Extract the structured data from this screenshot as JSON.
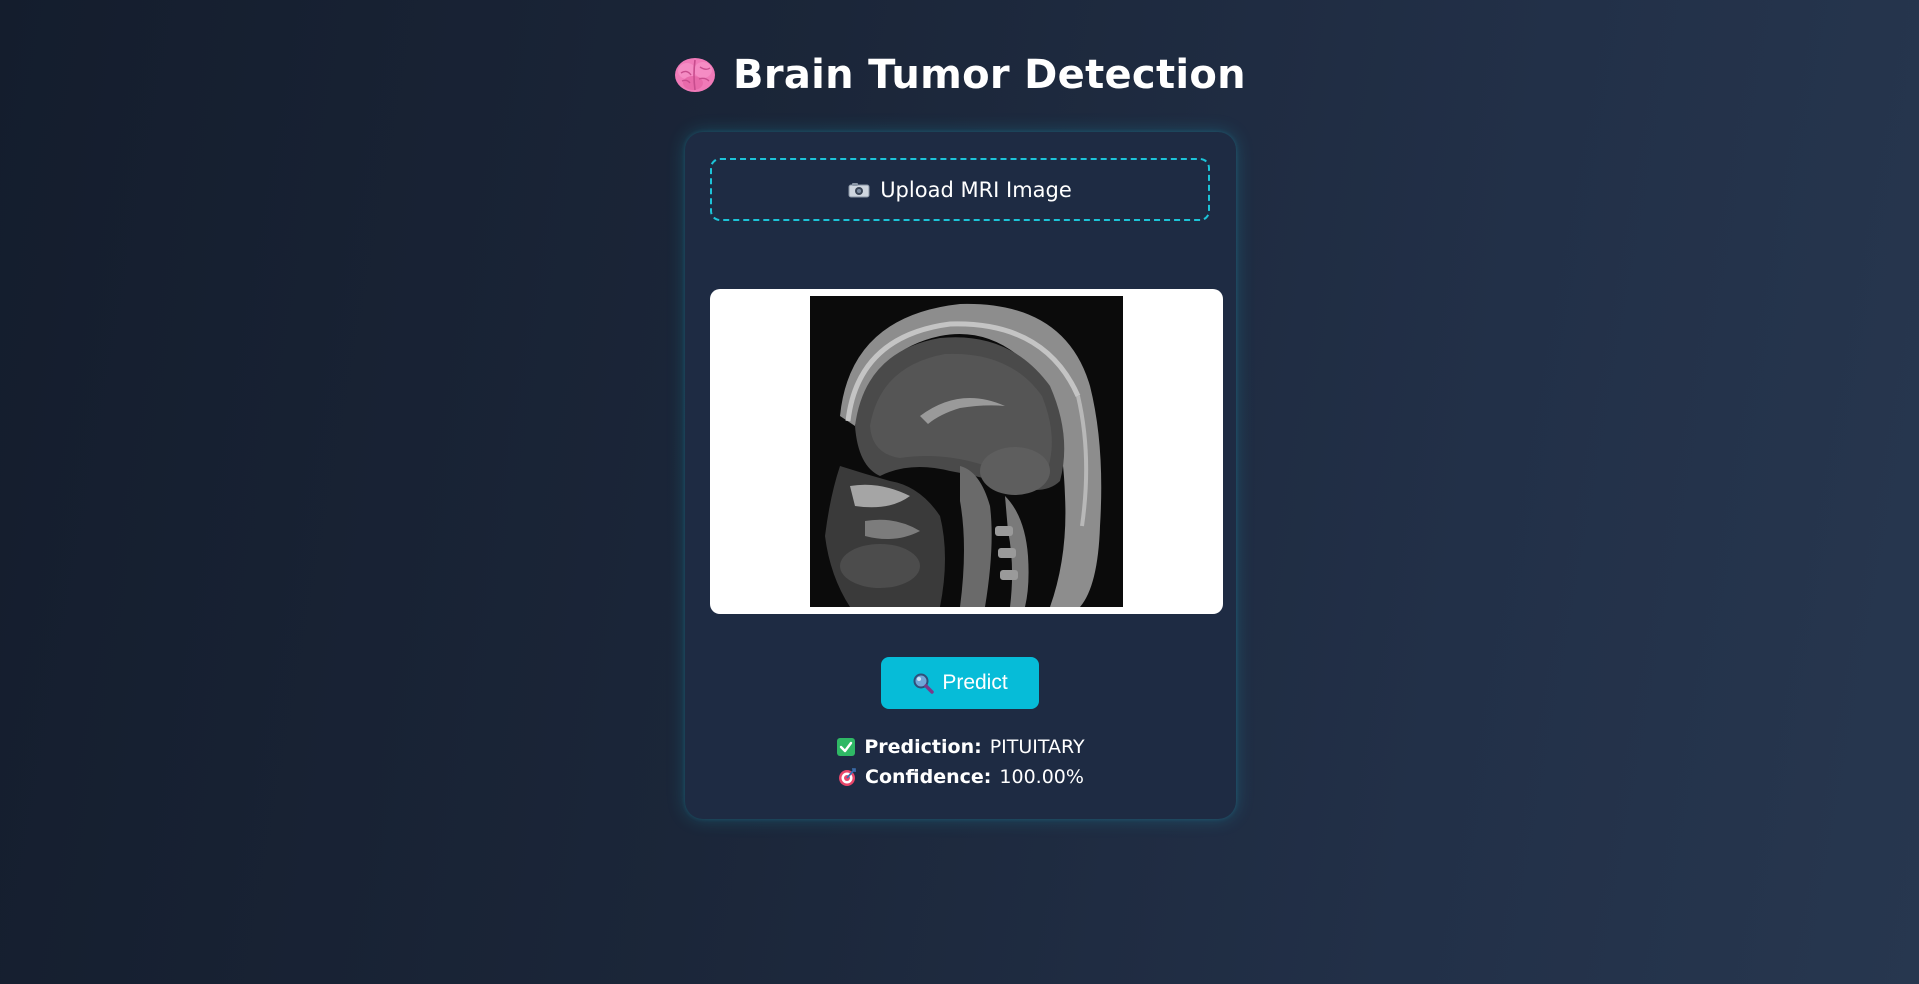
{
  "header": {
    "title": "Brain Tumor Detection",
    "icon": "brain-icon"
  },
  "upload": {
    "label": "Upload MRI Image",
    "icon": "camera-icon"
  },
  "preview": {
    "image": "mri-brain-sagittal"
  },
  "predict_button": {
    "label": "Predict",
    "icon": "magnifier-icon"
  },
  "results": {
    "prediction_label": "Prediction:",
    "prediction_value": "PITUITARY",
    "prediction_icon": "check-icon",
    "confidence_label": "Confidence:",
    "confidence_value": "100.00%",
    "confidence_icon": "target-icon"
  },
  "colors": {
    "accent": "#06bcd8",
    "card": "#1e2b43",
    "background": "#1b2639",
    "check": "#2fb865",
    "target": "#e8466a"
  }
}
